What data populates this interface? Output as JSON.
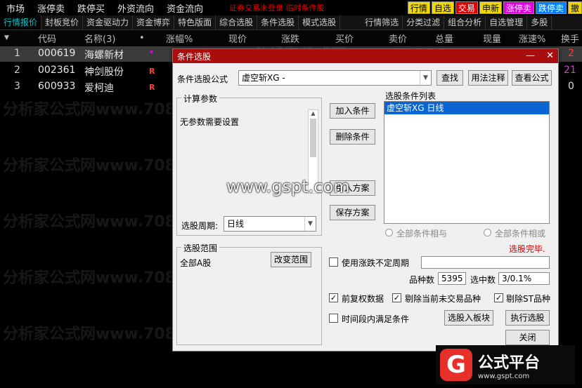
{
  "menubar": {
    "items": [
      "市场",
      "涨停卖",
      "跌停买",
      "外资流向",
      "资金流向"
    ],
    "status": "证券交易未登录  临时条件股",
    "quick": [
      {
        "label": "行情",
        "bg": "#f0d800",
        "fg": "#000"
      },
      {
        "label": "自选",
        "bg": "#f0d800",
        "fg": "#000"
      },
      {
        "label": "交易",
        "bg": "#e00000",
        "fg": "#fff"
      },
      {
        "label": "申新",
        "bg": "#f0d800",
        "fg": "#000"
      },
      {
        "label": "涨停卖",
        "bg": "#e000e0",
        "fg": "#fff"
      },
      {
        "label": "跌停卖",
        "bg": "#0080ff",
        "fg": "#fff"
      },
      {
        "label": "撤",
        "bg": "#f0d800",
        "fg": "#000"
      }
    ]
  },
  "tabs": [
    "行情报价",
    "封板竞价",
    "资金驱动力",
    "资金博弈",
    "特色版面",
    "综合选股",
    "条件选股",
    "模式选股",
    "行情筛选",
    "分类过滤",
    "组合分析",
    "自选管理",
    "多股"
  ],
  "table": {
    "headers": [
      "代码",
      "名称(3)",
      "•",
      "涨幅%",
      "现价",
      "涨跌",
      "买价",
      "卖价",
      "总量",
      "现量",
      "涨速%",
      "换手"
    ],
    "rows": [
      {
        "idx": "1",
        "code": "000619",
        "name": "海螺新材",
        "flag": "•",
        "tail": "2"
      },
      {
        "idx": "2",
        "code": "002361",
        "name": "神剑股份",
        "flag": "R",
        "tail": "21"
      },
      {
        "idx": "3",
        "code": "600933",
        "name": "爱柯迪",
        "flag": "R",
        "tail": "0"
      }
    ]
  },
  "watermark": {
    "text": "分析家公式网www.70822.com",
    "site": "www.gspt.com"
  },
  "dialog": {
    "title": "条件选股",
    "formula_label": "条件选股公式",
    "formula_value": "虚空斩XG  -",
    "find_button": "查找",
    "usage_button": "用法注释",
    "view_button": "查看公式",
    "params_group": "计算参数",
    "params_text": "无参数需要设置",
    "period_label": "选股周期:",
    "period_value": "日线",
    "add_button": "加入条件",
    "delete_button": "删除条件",
    "import_button": "引入方案",
    "save_button": "保存方案",
    "list_label": "选股条件列表",
    "list_items": [
      "虚空斩XG  日线"
    ],
    "radio_and": "全部条件相与",
    "radio_or": "全部条件相或",
    "status_text": "选股完毕.",
    "range_group": "选股范围",
    "range_value": "全部A股",
    "change_range_button": "改变范围",
    "uncertain_period_label": "使用涨跌不定周期",
    "count_label": "品种数",
    "count_value": "5395",
    "selected_label": "选中数",
    "selected_value": "3/0.1%",
    "fq_label": "前复权数据",
    "exclude_suspended_label": "剔除当前未交易品种",
    "exclude_st_label": "剔除ST品种",
    "time_range_label": "时间段内满足条件",
    "to_block_button": "选股入板块",
    "execute_button": "执行选股",
    "close_button": "关闭"
  },
  "logo": {
    "mark": "G",
    "title": "公式平台",
    "url": "www.gspt.com"
  }
}
